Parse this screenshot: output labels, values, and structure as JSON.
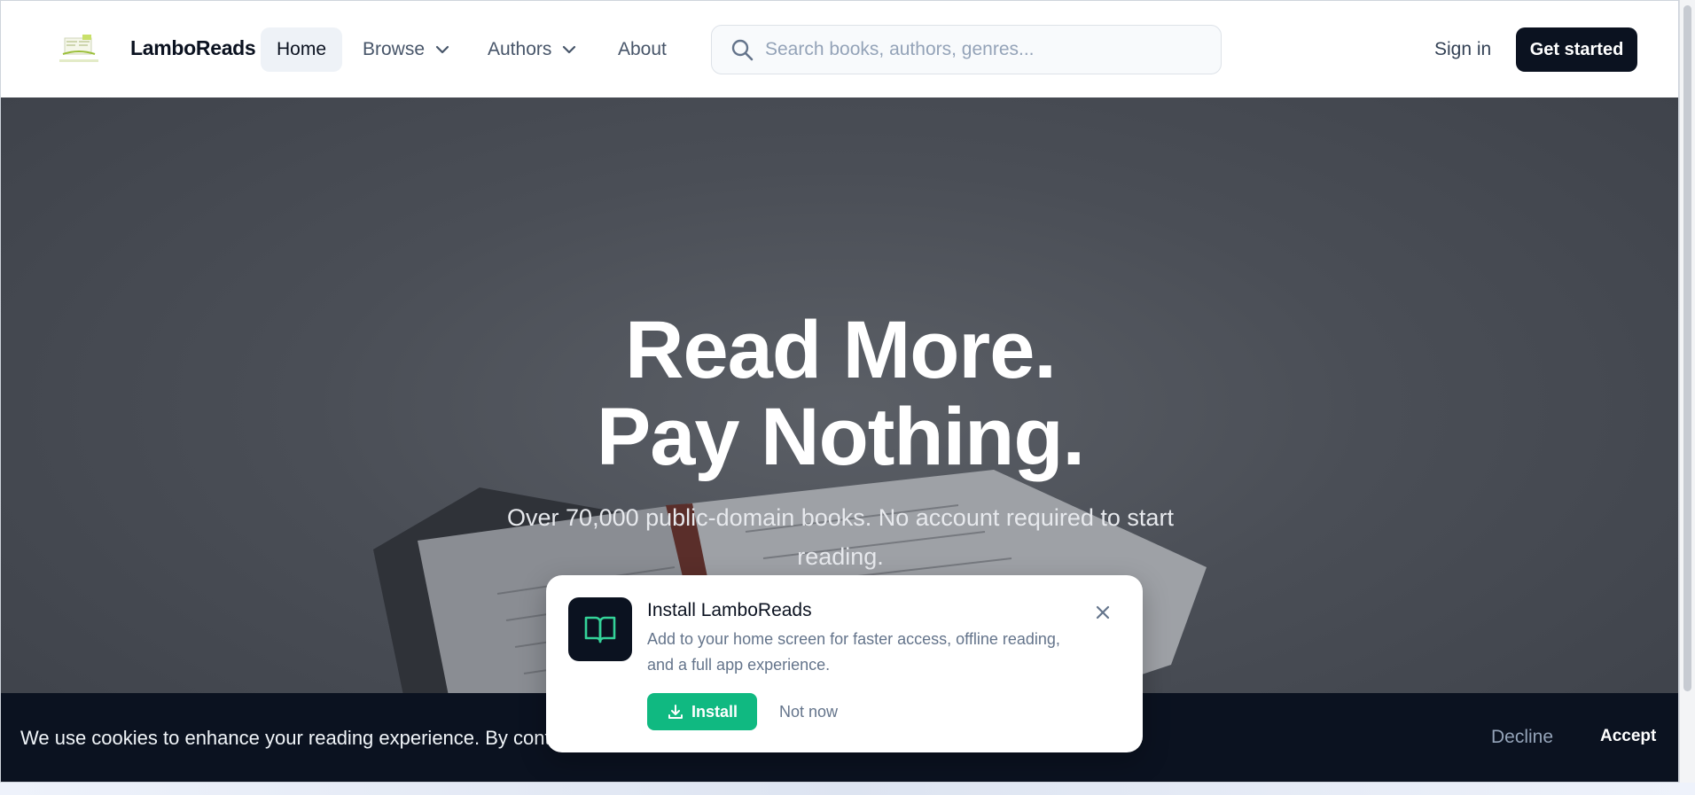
{
  "header": {
    "logo_icon": "lamboreads-logo",
    "brand": "LamboReads",
    "nav": {
      "home": "Home",
      "browse": "Browse",
      "authors": "Authors",
      "about": "About"
    },
    "search_placeholder": "Search books, authors, genres...",
    "sign_in": "Sign in",
    "get_started": "Get started"
  },
  "hero": {
    "title_line1": "Read More.",
    "title_line2": "Pay Nothing.",
    "subtitle": "Over 70,000 public-domain books. No account required to start reading."
  },
  "install_popup": {
    "icon": "open-book-icon",
    "title": "Install LamboReads",
    "description": "Add to your home screen for faster access, offline reading, and a full app experience.",
    "install_label": "Install",
    "not_now_label": "Not now"
  },
  "cookie_banner": {
    "text": "We use cookies to enhance your reading experience. By continuing",
    "decline": "Decline",
    "accept": "Accept"
  },
  "colors": {
    "primary_dark": "#0b1220",
    "accent_green": "#10b981",
    "muted": "#64748b"
  }
}
